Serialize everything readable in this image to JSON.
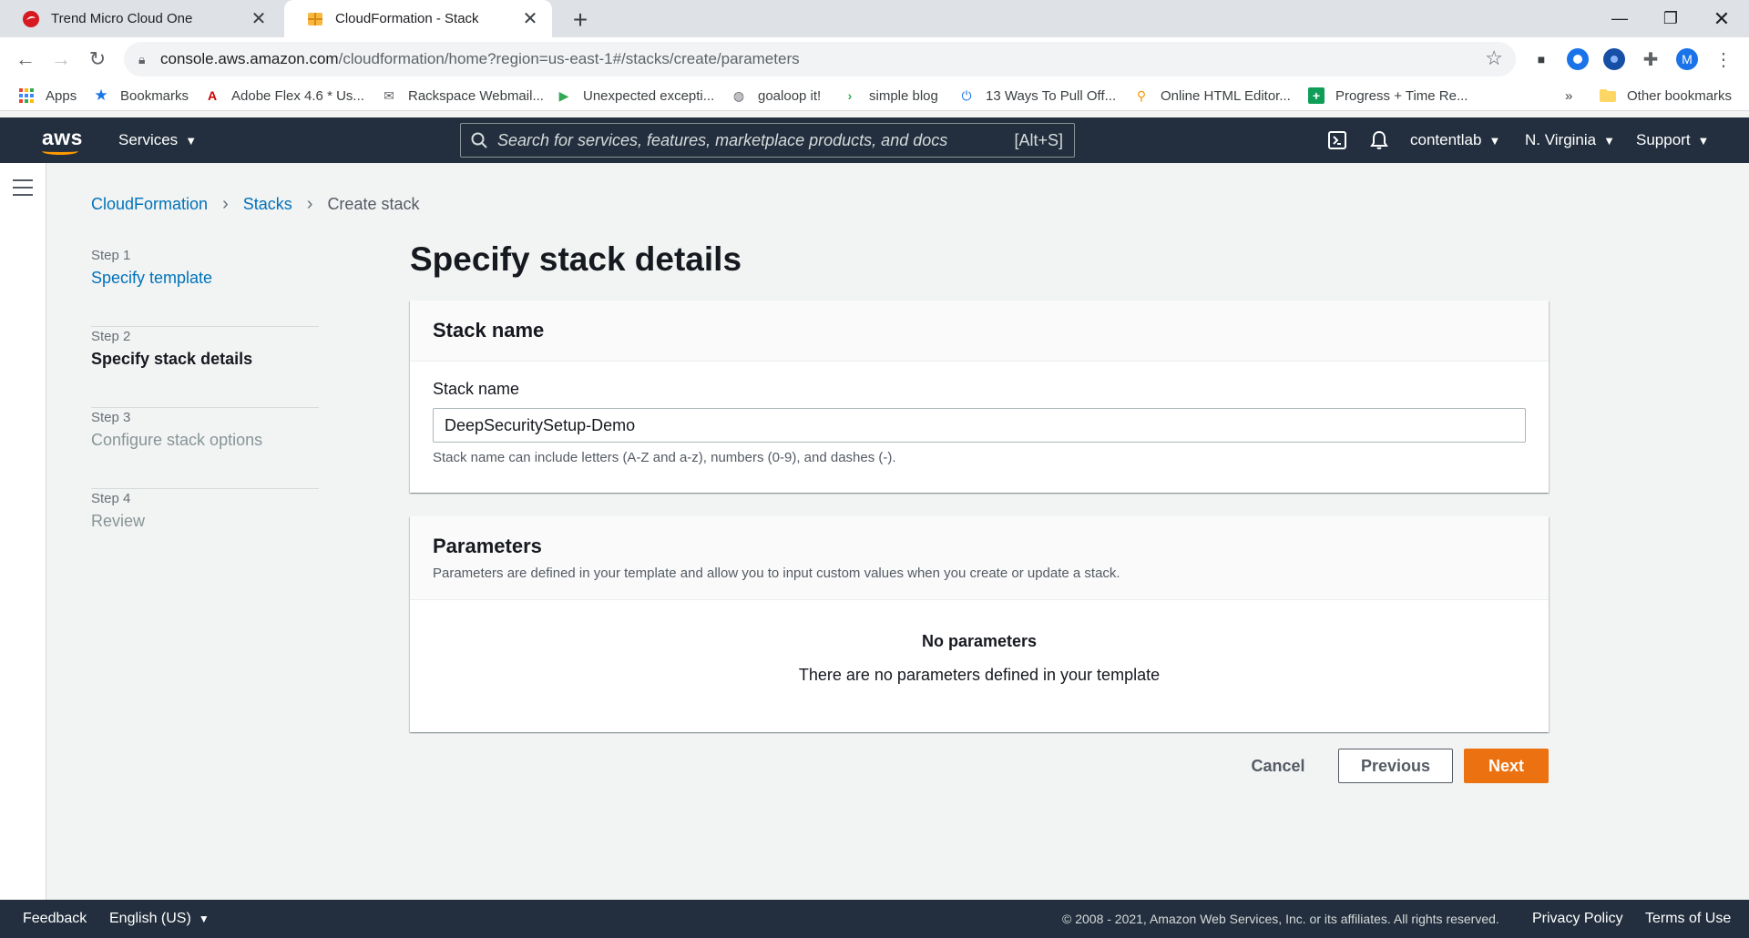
{
  "browser": {
    "tabs": [
      {
        "title": "Trend Micro Cloud One",
        "active": false,
        "icon": "trend-micro-icon"
      },
      {
        "title": "CloudFormation - Stack",
        "active": true,
        "icon": "cloudformation-icon"
      }
    ],
    "new_tab_glyph": "+",
    "url_host": "console.aws.amazon.com",
    "url_path": "/cloudformation/home?region=us-east-1#/stacks/create/parameters",
    "profile_initial": "M",
    "bookmarks": [
      {
        "label": "Apps",
        "icon": "apps-grid-icon"
      },
      {
        "label": "Bookmarks",
        "icon": "star-icon"
      },
      {
        "label": "Adobe Flex 4.6 * Us...",
        "icon": "adobe-icon"
      },
      {
        "label": "Rackspace Webmail...",
        "icon": "mail-icon"
      },
      {
        "label": "Unexpected excepti...",
        "icon": "play-arrow-icon"
      },
      {
        "label": "goaloop it!",
        "icon": "globe-icon"
      },
      {
        "label": "simple blog",
        "icon": "chevron-icon"
      },
      {
        "label": "13 Ways To Pull Off...",
        "icon": "power-icon"
      },
      {
        "label": "Online HTML Editor...",
        "icon": "search-orange-icon"
      },
      {
        "label": "Progress + Time Re...",
        "icon": "sheets-icon"
      }
    ],
    "bookmarks_overflow": "»",
    "other_bookmarks": "Other bookmarks"
  },
  "aws_header": {
    "logo_text": "aws",
    "services_label": "Services",
    "search_placeholder": "Search for services, features, marketplace products, and docs",
    "search_shortcut": "[Alt+S]",
    "account": "contentlab",
    "region": "N. Virginia",
    "support": "Support"
  },
  "breadcrumb": {
    "items": [
      "CloudFormation",
      "Stacks"
    ],
    "current": "Create stack"
  },
  "steps": [
    {
      "num": "Step 1",
      "name": "Specify template",
      "state": "link"
    },
    {
      "num": "Step 2",
      "name": "Specify stack details",
      "state": "current"
    },
    {
      "num": "Step 3",
      "name": "Configure stack options",
      "state": "disabled"
    },
    {
      "num": "Step 4",
      "name": "Review",
      "state": "disabled"
    }
  ],
  "main": {
    "title": "Specify stack details",
    "stack_panel": {
      "heading": "Stack name",
      "field_label": "Stack name",
      "field_value": "DeepSecuritySetup-Demo",
      "hint": "Stack name can include letters (A-Z and a-z), numbers (0-9), and dashes (-)."
    },
    "params_panel": {
      "heading": "Parameters",
      "description": "Parameters are defined in your template and allow you to input custom values when you create or update a stack.",
      "empty_title": "No parameters",
      "empty_text": "There are no parameters defined in your template"
    },
    "actions": {
      "cancel": "Cancel",
      "previous": "Previous",
      "next": "Next"
    }
  },
  "footer": {
    "feedback": "Feedback",
    "language": "English (US)",
    "copyright": "© 2008 - 2021, Amazon Web Services, Inc. or its affiliates. All rights reserved.",
    "privacy": "Privacy Policy",
    "terms": "Terms of Use"
  },
  "colors": {
    "aws_header_bg": "#232f3e",
    "aws_orange": "#ec7211",
    "link_blue": "#0073bb"
  }
}
